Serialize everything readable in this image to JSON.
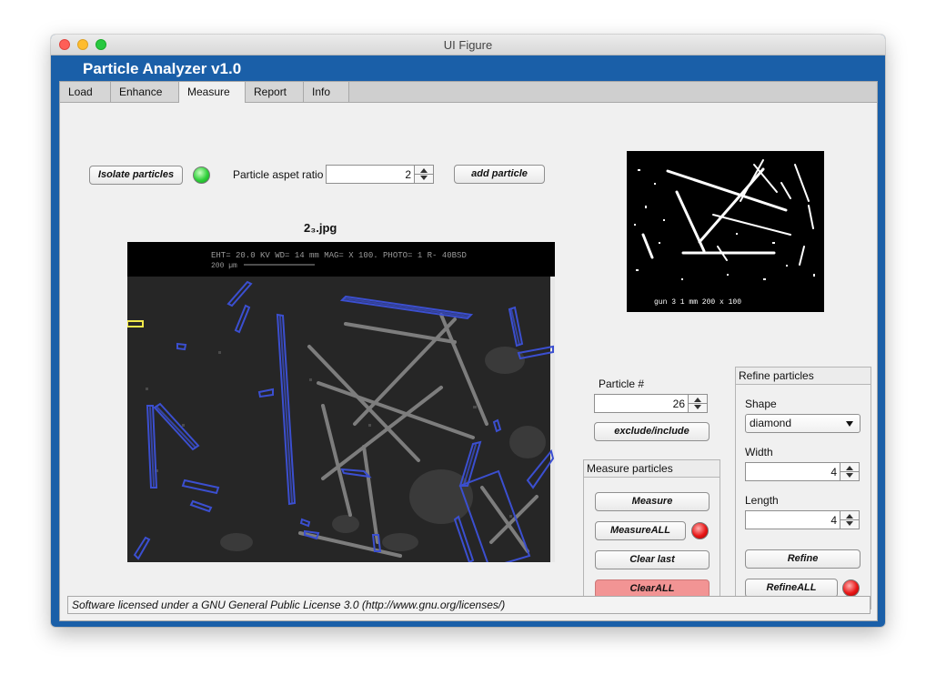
{
  "window": {
    "title": "UI Figure"
  },
  "app": {
    "title": "Particle Analyzer  v1.0"
  },
  "tabs": [
    {
      "label": "Load",
      "active": false
    },
    {
      "label": "Enhance",
      "active": false
    },
    {
      "label": "Measure",
      "active": true
    },
    {
      "label": "Report",
      "active": false
    },
    {
      "label": "Info",
      "active": false
    }
  ],
  "isolate": {
    "button_label": "Isolate particles",
    "aspect_label": "Particle aspet ratio",
    "aspect_value": "2",
    "add_label": "add particle",
    "lamp_color": "#2fd03a"
  },
  "image": {
    "title": "2₃.jpg",
    "sem_header": "EHT= 20.0 KV   WD= 14  mm      MAG= X 100.   PHOTO= 1        R- 40BSD",
    "scale_label": "200 µm",
    "preview_footer": "gun 3   1 mm   200 x 100"
  },
  "particle": {
    "label": "Particle #",
    "value": "26",
    "toggle_label": "exclude/include"
  },
  "measure": {
    "title": "Measure particles",
    "measure_label": "Measure",
    "measure_all_label": "MeasureALL",
    "clear_last_label": "Clear last",
    "clear_all_label": "ClearALL",
    "lamp_color": "#e81616"
  },
  "refine": {
    "title": "Refine particles",
    "shape_label": "Shape",
    "shape_value": "diamond",
    "width_label": "Width",
    "width_value": "4",
    "length_label": "Length",
    "length_value": "4",
    "refine_label": "Refine",
    "refine_all_label": "RefineALL",
    "lamp_color": "#e81616"
  },
  "status": {
    "text": "Software licensed under a GNU General Public License 3.0 (http://www.gnu.org/licenses/)"
  },
  "colors": {
    "frame": "#1a5fa8",
    "highlight": "#3b4fd0",
    "selection": "#f2e94a"
  }
}
